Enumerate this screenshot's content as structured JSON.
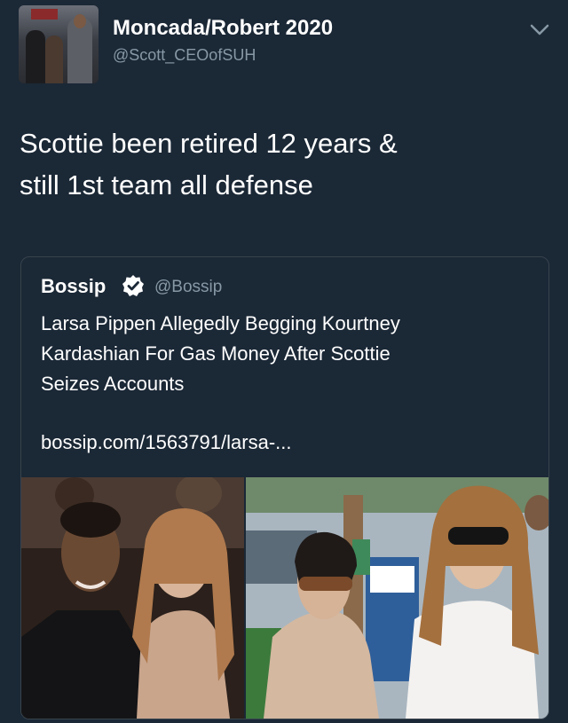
{
  "author": {
    "display_name": "Moncada/Robert 2020",
    "handle": "@Scott_CEOofSUH",
    "avatar_icon": "profile-photo"
  },
  "tweet": {
    "text_line1": "Scottie been retired 12 years &",
    "text_line2": "still 1st team all defense"
  },
  "quoted": {
    "name": "Bossip",
    "handle": "@Bossip",
    "verified_icon": "verified-badge-icon",
    "text_line1": "Larsa Pippen Allegedly Begging Kourtney",
    "text_line2": "Kardashian For Gas Money After Scottie",
    "text_line3": "Seizes Accounts",
    "link": "bossip.com/1563791/larsa-..."
  },
  "colors": {
    "background": "#1b2836",
    "secondary_text": "#8899a6",
    "card_border": "#38444d"
  }
}
